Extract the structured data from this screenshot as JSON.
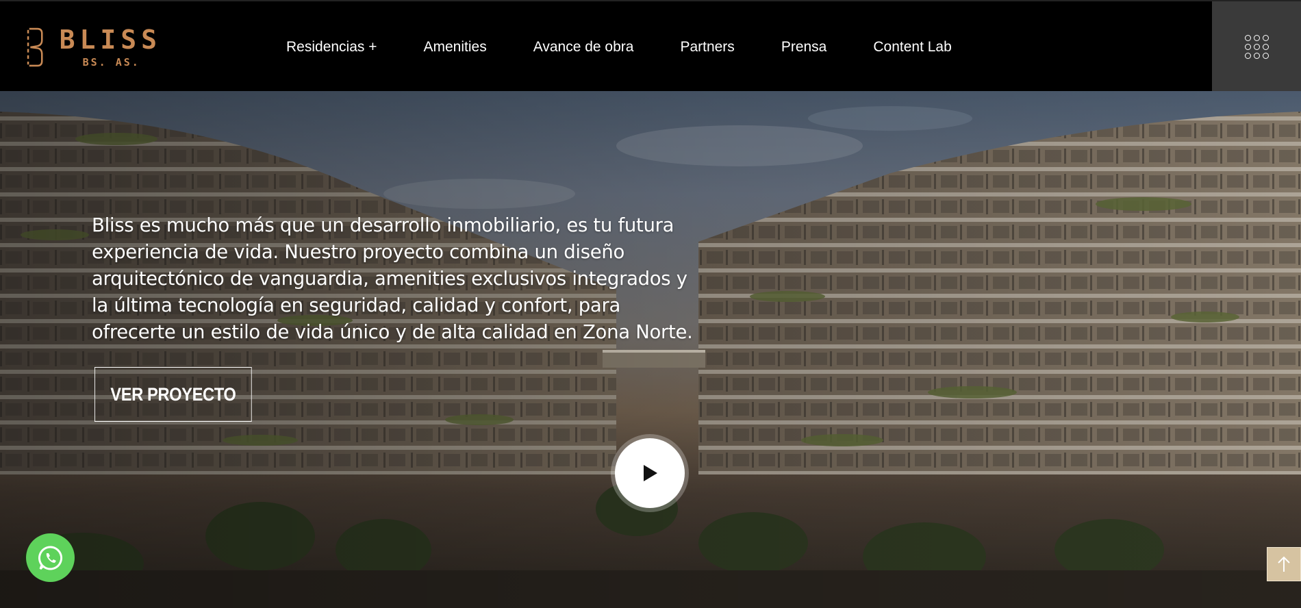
{
  "brand": {
    "name": "BLISS",
    "sub": "BS. AS.",
    "color": "#c98a55"
  },
  "nav": {
    "items": [
      {
        "label": "Residencias +"
      },
      {
        "label": "Amenities"
      },
      {
        "label": "Avance de obra"
      },
      {
        "label": "Partners"
      },
      {
        "label": "Prensa"
      },
      {
        "label": "Content Lab"
      }
    ],
    "menu_icon": "grid-dots-icon"
  },
  "hero": {
    "text": "Bliss es mucho más que un desarrollo inmobiliario, es tu futura experiencia de vida. Nuestro proyecto combina un diseño arquitectónico de vanguardia, amenities exclusivos integrados y la última tecnología en seguridad, calidad y confort, para ofrecerte un estilo de vida único y de alta calidad en Zona Norte.",
    "cta_label": "VER PROYECTO",
    "play_icon": "play-icon"
  },
  "floating": {
    "whatsapp_icon": "whatsapp-icon",
    "whatsapp_color": "#5ed25b",
    "to_top_icon": "arrow-up-icon",
    "to_top_color": "#d6c3a1"
  }
}
